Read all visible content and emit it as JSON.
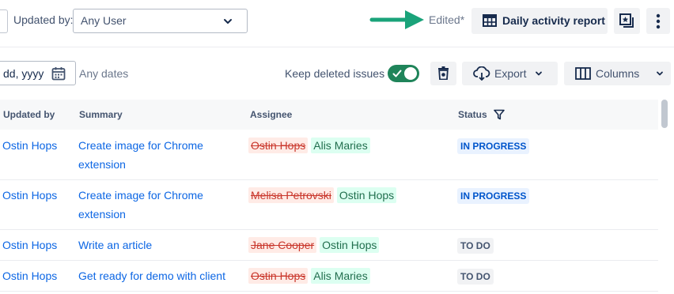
{
  "filters": {
    "updated_by_label": "Updated by:",
    "updated_by_value": "Any User",
    "date_value": "dd, yyyy",
    "any_dates": "Any dates",
    "keep_deleted_label": "Keep deleted issues",
    "keep_deleted_on": true
  },
  "toolbar": {
    "edited": "Edited*",
    "daily_report": "Daily activity report",
    "export": "Export",
    "columns": "Columns"
  },
  "table": {
    "headers": {
      "updated_by": "Updated by",
      "summary": "Summary",
      "assignee": "Assignee",
      "status": "Status"
    },
    "rows": [
      {
        "updated_by": "Ostin Hops",
        "summary": "Create image for Chrome extension",
        "assignee_old": "Ostin Hops",
        "assignee_new": "Alis Maries",
        "status": "IN PROGRESS"
      },
      {
        "updated_by": "Ostin Hops",
        "summary": "Create image for Chrome extension",
        "assignee_old": "Melisa Petrovski",
        "assignee_new": "Ostin Hops",
        "status": "IN PROGRESS"
      },
      {
        "updated_by": "Ostin Hops",
        "summary": "Write an article",
        "assignee_old": "Jane Cooper",
        "assignee_new": "Ostin Hops",
        "status": "TO DO"
      },
      {
        "updated_by": "Ostin Hops",
        "summary": "Get ready for demo with client",
        "assignee_old": "Ostin Hops",
        "assignee_new": "Alis Maries",
        "status": "TO DO"
      }
    ]
  },
  "colors": {
    "annotation_arrow": "#1aa37a",
    "toggle_on": "#1f845a",
    "link": "#0c66e4"
  },
  "icons": [
    "chevron-down-icon",
    "arrow-annotation-icon",
    "table-icon",
    "star-document-icon",
    "more-vertical-icon",
    "calendar-icon",
    "check-icon",
    "trash-icon",
    "cloud-download-icon",
    "columns-icon",
    "filter-icon"
  ]
}
